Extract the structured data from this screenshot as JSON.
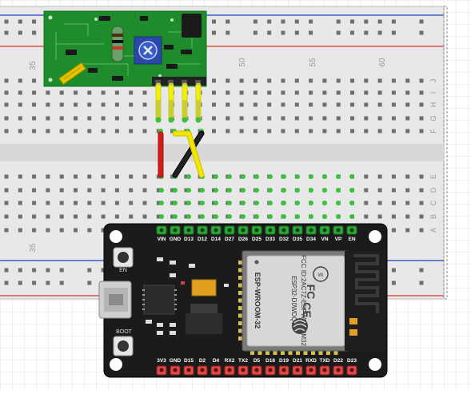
{
  "breadboard": {
    "column_numbers": [
      "35",
      "50",
      "55",
      "60"
    ],
    "row_letters_top": [
      "J",
      "I",
      "H",
      "G",
      "F"
    ],
    "row_letters_bottom": [
      "E",
      "D",
      "C",
      "B",
      "A"
    ]
  },
  "esp32": {
    "top_pins": [
      "VIN",
      "GND",
      "D13",
      "D12",
      "D14",
      "D27",
      "D26",
      "D25",
      "D33",
      "D32",
      "D35",
      "D34",
      "VN",
      "VP",
      "EN"
    ],
    "bottom_pins": [
      "3V3",
      "GND",
      "D15",
      "D2",
      "D4",
      "RX2",
      "TX2",
      "D5",
      "D18",
      "D19",
      "D21",
      "RXD",
      "TXD",
      "D22",
      "D23"
    ],
    "en_button_label": "EN",
    "boot_button_label": "BOOT",
    "module_lines": [
      "ESP-WROOM-32",
      "FCC ID:2AC7Z-ESPWROOM32",
      "ESP32-D0WDQ6",
      "CE"
    ]
  },
  "colors": {
    "breadboard": "#e6e6e6",
    "rail_red": "#d9534f",
    "rail_blue": "#3b5bbf",
    "pcb_green": "#1e8c2a",
    "esp_board": "#1b1b1b",
    "wire_red": "#d21c1c",
    "wire_black": "#111111",
    "wire_yellow": "#f2e600",
    "pin_highlight": "#39c23a"
  },
  "icons": [
    "wifi-logo-icon",
    "ce-mark-icon",
    "espressif-logo-icon",
    "potentiometer-icon",
    "antenna-trace-icon"
  ]
}
